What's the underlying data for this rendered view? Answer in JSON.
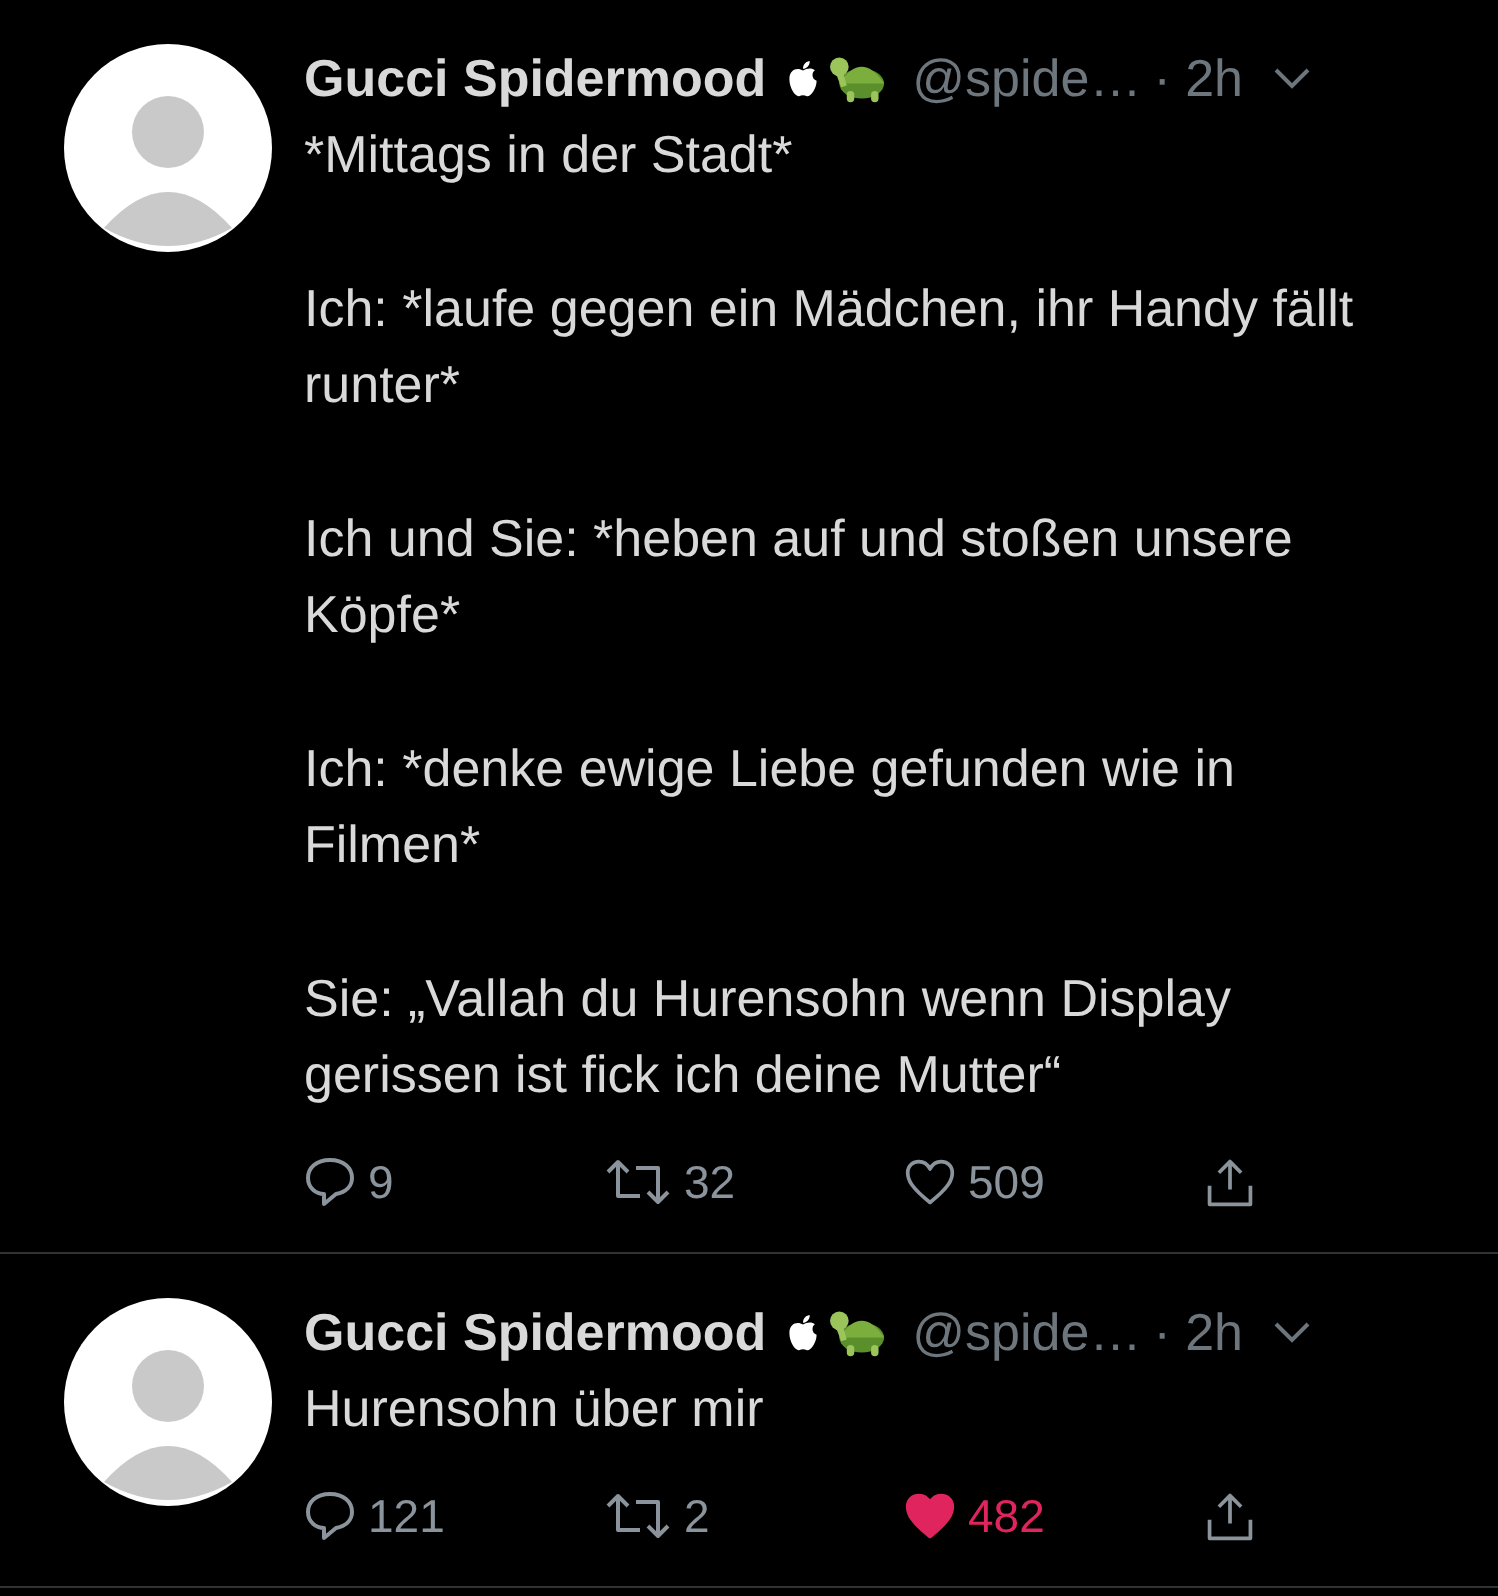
{
  "tweets": [
    {
      "name": "Gucci Spidermood",
      "handle": "@spide…",
      "time": "· 2h",
      "paragraphs": [
        "*Mittags in der Stadt*",
        "Ich: *laufe gegen ein Mädchen, ihr Handy fällt runter*",
        "Ich und Sie: *heben auf und stoßen unsere Köpfe*",
        "Ich: *denke ewige Liebe gefunden wie in Filmen*",
        "Sie: „Vallah du Hurensohn wenn Display gerissen ist fick ich deine Mutter“"
      ],
      "replies": "9",
      "retweets": "32",
      "likes": "509",
      "liked": false
    },
    {
      "name": "Gucci Spidermood",
      "handle": "@spide…",
      "time": "· 2h",
      "paragraphs": [
        "Hurensohn über mir"
      ],
      "replies": "121",
      "retweets": "2",
      "likes": "482",
      "liked": true
    }
  ]
}
